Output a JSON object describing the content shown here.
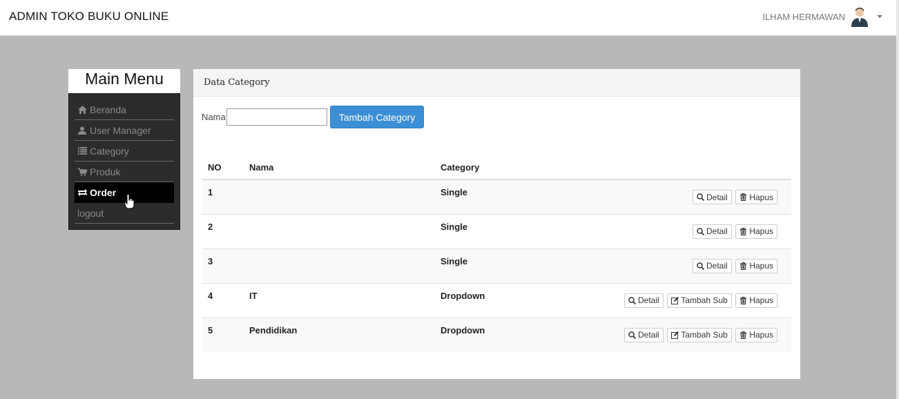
{
  "header": {
    "brand": "ADMIN TOKO BUKU ONLINE",
    "user_name": "ILHAM HERMAWAN"
  },
  "sidebar": {
    "title": "Main Menu",
    "items": [
      {
        "label": "Beranda",
        "icon": "home-icon"
      },
      {
        "label": "User Manager",
        "icon": "user-icon"
      },
      {
        "label": "Category",
        "icon": "list-icon"
      },
      {
        "label": "Produk",
        "icon": "cart-icon"
      },
      {
        "label": "Order",
        "icon": "transfer-icon",
        "active": true
      },
      {
        "label": "logout"
      }
    ]
  },
  "panel": {
    "title": "Data Category",
    "form": {
      "name_label": "Nama",
      "name_value": "",
      "add_button": "Tambah Category"
    },
    "table": {
      "headers": [
        "NO",
        "Nama",
        "Category"
      ],
      "rows": [
        {
          "no": "1",
          "nama": "",
          "category": "Single"
        },
        {
          "no": "2",
          "nama": "",
          "category": "Single"
        },
        {
          "no": "3",
          "nama": "",
          "category": "Single"
        },
        {
          "no": "4",
          "nama": "IT",
          "category": "Dropdown"
        },
        {
          "no": "5",
          "nama": "Pendidikan",
          "category": "Dropdown"
        }
      ]
    },
    "actions": {
      "detail": "Detail",
      "add_sub": "Tambah Sub",
      "delete": "Hapus"
    }
  },
  "colors": {
    "primary_button": "#3b8fd6",
    "sidebar_bg": "#2c2c2c",
    "page_bg": "#b8b8b8"
  }
}
